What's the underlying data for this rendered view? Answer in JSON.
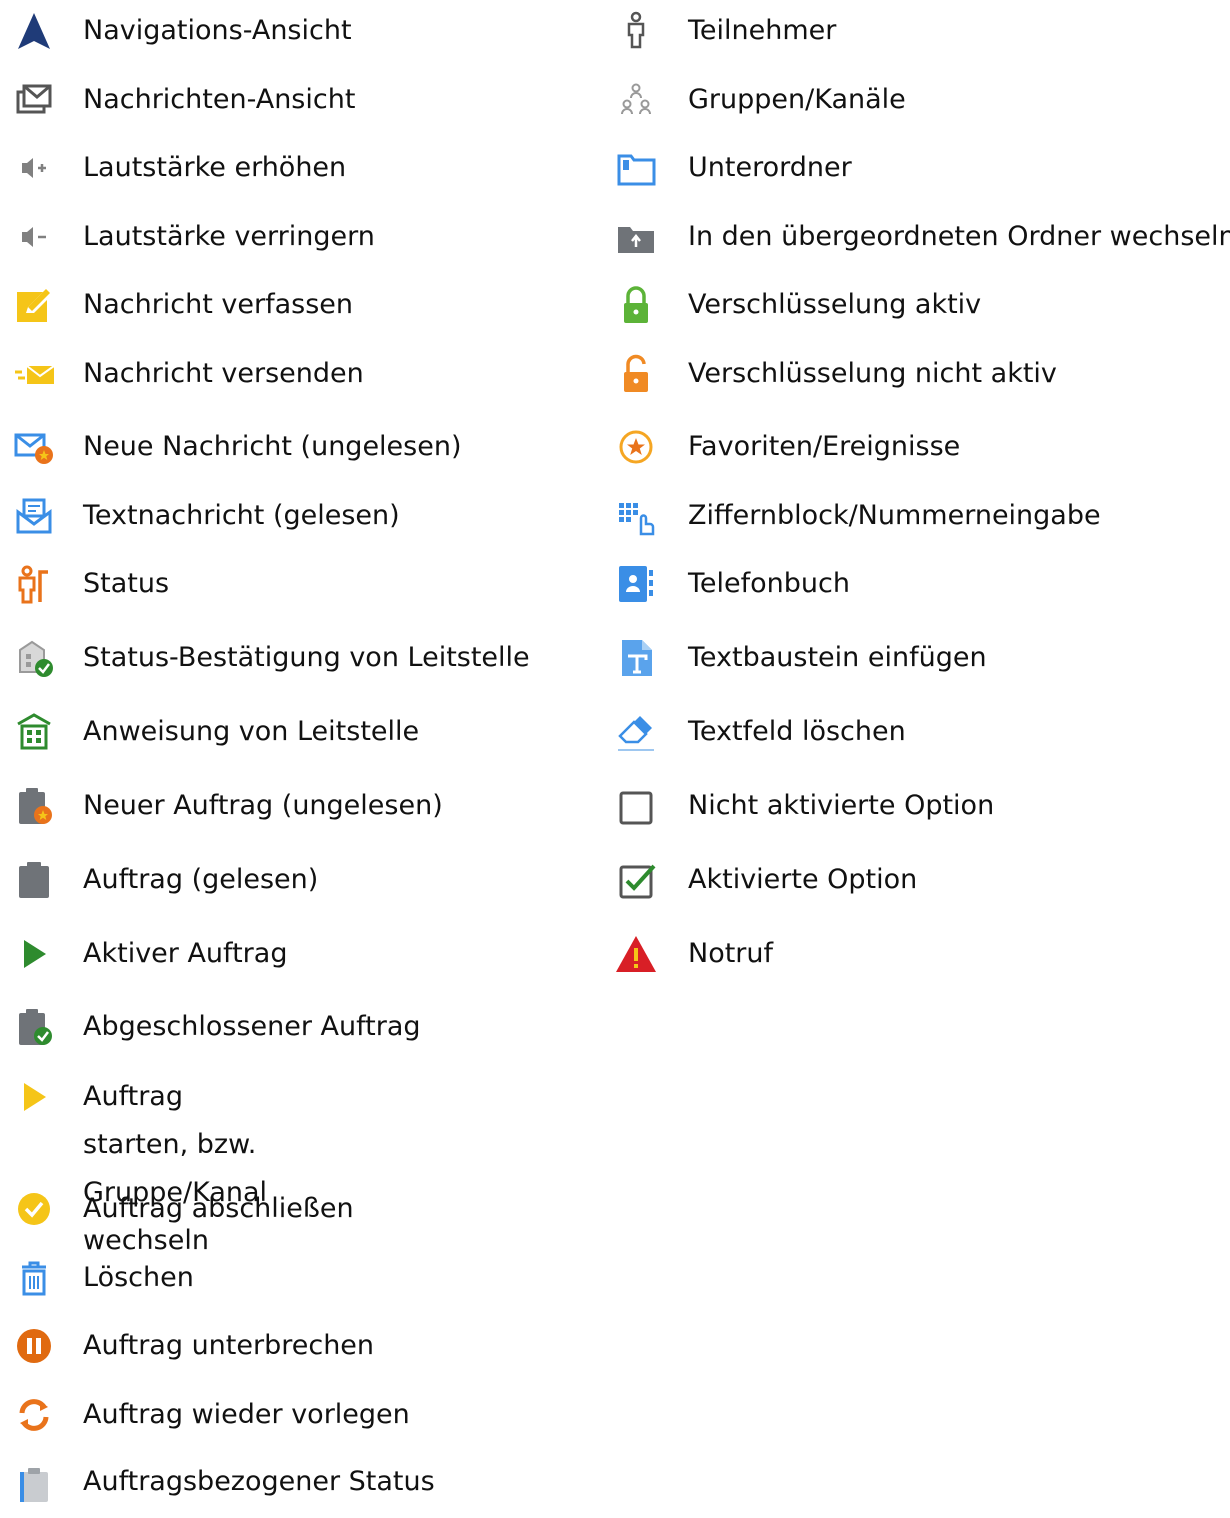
{
  "left_column": [
    {
      "icon": "navigation-arrow-icon",
      "label": "Navigations-Ansicht"
    },
    {
      "icon": "messages-view-icon",
      "label": "Nachrichten-Ansicht"
    },
    {
      "icon": "volume-up-icon",
      "label": "Lautstärke erhöhen"
    },
    {
      "icon": "volume-down-icon",
      "label": "Lautstärke verringern"
    },
    {
      "icon": "compose-message-icon",
      "label": "Nachricht verfassen"
    },
    {
      "icon": "send-message-icon",
      "label": "Nachricht versenden"
    },
    {
      "icon": "new-message-unread-icon",
      "label": "Neue Nachricht (ungelesen)"
    },
    {
      "icon": "text-message-read-icon",
      "label": "Textnachricht (gelesen)"
    },
    {
      "icon": "status-icon",
      "label": "Status"
    },
    {
      "icon": "status-confirmation-icon",
      "label": "Status-Bestätigung von Leitstelle"
    },
    {
      "icon": "dispatch-instruction-icon",
      "label": "Anweisung von Leitstelle"
    },
    {
      "icon": "new-order-unread-icon",
      "label": "Neuer Auftrag (ungelesen)"
    },
    {
      "icon": "order-read-icon",
      "label": "Auftrag (gelesen)"
    },
    {
      "icon": "active-order-play-icon",
      "label": "Aktiver Auftrag"
    },
    {
      "icon": "completed-order-icon",
      "label": "Abgeschlossener Auftrag"
    },
    {
      "icon": "start-order-icon",
      "label": "Auftrag starten, bzw.\nGruppe/Kanal wechseln"
    },
    {
      "icon": "complete-order-check-icon",
      "label": "Auftrag abschließen"
    },
    {
      "icon": "delete-trash-icon",
      "label": "Löschen"
    },
    {
      "icon": "pause-order-icon",
      "label": "Auftrag unterbrechen"
    },
    {
      "icon": "resubmit-order-icon",
      "label": "Auftrag wieder vorlegen"
    },
    {
      "icon": "order-status-icon",
      "label": "Auftragsbezogener Status"
    }
  ],
  "right_column": [
    {
      "icon": "participant-icon",
      "label": "Teilnehmer"
    },
    {
      "icon": "groups-channels-icon",
      "label": "Gruppen/Kanäle"
    },
    {
      "icon": "subfolder-icon",
      "label": "Unterordner"
    },
    {
      "icon": "parent-folder-icon",
      "label": "In den übergeordneten Ordner wechseln"
    },
    {
      "icon": "lock-closed-icon",
      "label": "Verschlüsselung aktiv"
    },
    {
      "icon": "lock-open-icon",
      "label": "Verschlüsselung nicht aktiv"
    },
    {
      "icon": "favorites-star-icon",
      "label": "Favoriten/Ereignisse"
    },
    {
      "icon": "keypad-icon",
      "label": "Ziffernblock/Nummerneingabe"
    },
    {
      "icon": "phonebook-icon",
      "label": "Telefonbuch"
    },
    {
      "icon": "insert-text-block-icon",
      "label": "Textbaustein einfügen"
    },
    {
      "icon": "eraser-icon",
      "label": "Textfeld löschen"
    },
    {
      "icon": "checkbox-unchecked-icon",
      "label": "Nicht aktivierte Option"
    },
    {
      "icon": "checkbox-checked-icon",
      "label": "Aktivierte Option"
    },
    {
      "icon": "emergency-warning-icon",
      "label": "Notruf"
    }
  ],
  "colors": {
    "navy": "#1f3b78",
    "gray": "#6f7378",
    "yellow": "#f5c518",
    "blue": "#3a8ee6",
    "orange": "#e9731b",
    "green": "#2e8b2e",
    "red": "#d81f26"
  }
}
